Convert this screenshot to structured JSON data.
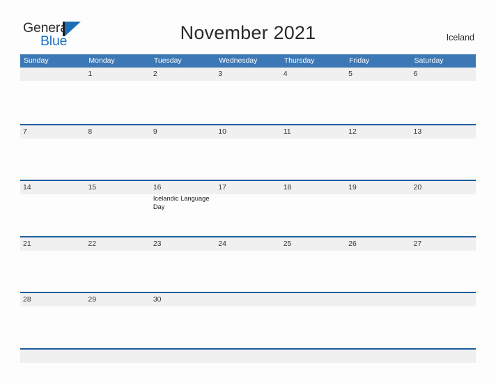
{
  "brand": {
    "word_one": "General",
    "word_two": "Blue",
    "flag_icon": "blue-flag-triangle-icon",
    "color_general": "#2b2b2b",
    "color_blue": "#1a72c4",
    "color_flag": "#1b6fb8"
  },
  "header": {
    "title": "November 2021",
    "region": "Iceland"
  },
  "theme": {
    "header_blue": "#3c78b5",
    "rule_blue": "#1f5c9e",
    "band_gray": "#f0f0f0",
    "page_background": "#fdfdfd",
    "day_text": "#333333"
  },
  "calendar": {
    "month": "November",
    "year": "2021",
    "weekday_headers": [
      "Sunday",
      "Monday",
      "Tuesday",
      "Wednesday",
      "Thursday",
      "Friday",
      "Saturday"
    ],
    "weeks": [
      [
        {
          "day": "",
          "events": []
        },
        {
          "day": "1",
          "events": []
        },
        {
          "day": "2",
          "events": []
        },
        {
          "day": "3",
          "events": []
        },
        {
          "day": "4",
          "events": []
        },
        {
          "day": "5",
          "events": []
        },
        {
          "day": "6",
          "events": []
        }
      ],
      [
        {
          "day": "7",
          "events": []
        },
        {
          "day": "8",
          "events": []
        },
        {
          "day": "9",
          "events": []
        },
        {
          "day": "10",
          "events": []
        },
        {
          "day": "11",
          "events": []
        },
        {
          "day": "12",
          "events": []
        },
        {
          "day": "13",
          "events": []
        }
      ],
      [
        {
          "day": "14",
          "events": []
        },
        {
          "day": "15",
          "events": []
        },
        {
          "day": "16",
          "events": [
            "Icelandic Language Day"
          ]
        },
        {
          "day": "17",
          "events": []
        },
        {
          "day": "18",
          "events": []
        },
        {
          "day": "19",
          "events": []
        },
        {
          "day": "20",
          "events": []
        }
      ],
      [
        {
          "day": "21",
          "events": []
        },
        {
          "day": "22",
          "events": []
        },
        {
          "day": "23",
          "events": []
        },
        {
          "day": "24",
          "events": []
        },
        {
          "day": "25",
          "events": []
        },
        {
          "day": "26",
          "events": []
        },
        {
          "day": "27",
          "events": []
        }
      ],
      [
        {
          "day": "28",
          "events": []
        },
        {
          "day": "29",
          "events": []
        },
        {
          "day": "30",
          "events": []
        },
        {
          "day": "",
          "events": []
        },
        {
          "day": "",
          "events": []
        },
        {
          "day": "",
          "events": []
        },
        {
          "day": "",
          "events": []
        }
      ]
    ]
  }
}
